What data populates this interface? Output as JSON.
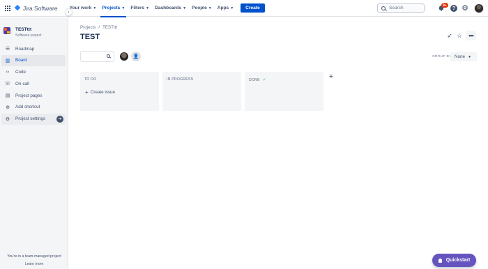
{
  "topnav": {
    "logo_text": "Jira Software",
    "items": [
      {
        "label": "Your work",
        "active": false
      },
      {
        "label": "Projects",
        "active": true
      },
      {
        "label": "Filters",
        "active": false
      },
      {
        "label": "Dashboards",
        "active": false
      },
      {
        "label": "People",
        "active": false
      },
      {
        "label": "Apps",
        "active": false
      }
    ],
    "create_label": "Create",
    "search_placeholder": "Search",
    "notification_count": "9+",
    "help_glyph": "?"
  },
  "sidebar": {
    "project_name": "TESTttt",
    "project_type": "Software project",
    "items": [
      {
        "label": "Roadmap",
        "icon": "roadmap-icon"
      },
      {
        "label": "Board",
        "icon": "board-icon",
        "active": true
      },
      {
        "label": "Code",
        "icon": "code-icon"
      },
      {
        "label": "On-call",
        "icon": "on-call-icon"
      },
      {
        "label": "Project pages",
        "icon": "pages-icon"
      },
      {
        "label": "Add shortcut",
        "icon": "add-shortcut-icon"
      },
      {
        "label": "Project settings",
        "icon": "gear-icon"
      }
    ],
    "footer_text": "You're in a team-managed project",
    "learn_more": "Learn more"
  },
  "main": {
    "breadcrumb": [
      "Projects",
      "/",
      "TESTttt"
    ],
    "title": "TEST",
    "group_by_label": "GROUP BY",
    "group_by_value": "None",
    "columns": [
      {
        "title": "TO DO",
        "done": false,
        "create_label": "Create issue"
      },
      {
        "title": "IN PROGRESS",
        "done": false
      },
      {
        "title": "DONE",
        "done": true
      }
    ]
  },
  "quickstart_label": "Quickstart",
  "colors": {
    "primary": "#0052cc",
    "quickstart": "#6554c0",
    "badge": "#de350b",
    "done_check": "#36b37e"
  }
}
